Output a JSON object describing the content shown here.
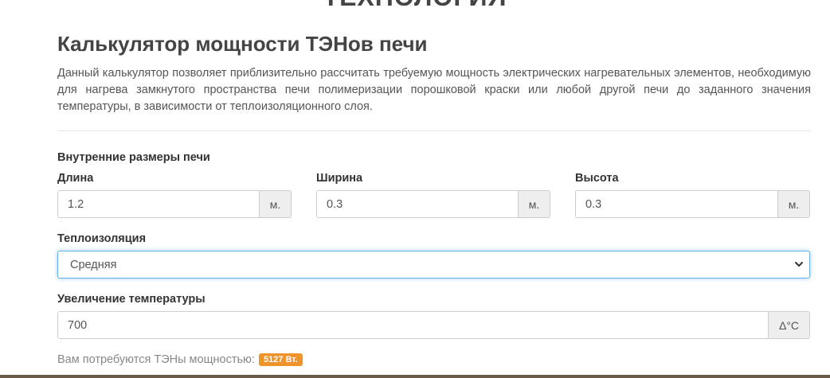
{
  "header": {
    "cut_heading": "ТЕХНОЛОГИЯ"
  },
  "calculator": {
    "title": "Калькулятор мощности ТЭНов печи",
    "description": "Данный калькулятор позволяет приблизительно рассчитать требуемую мощность электрических нагревательных элементов, необходимую для  нагрева замкнутого пространства печи полимеризации порошковой краски или любой другой печи до заданного значения температуры, в зависимости от теплоизоляционного слоя.",
    "dimensions_label": "Внутренние размеры печи",
    "length": {
      "label": "Длина",
      "value": "1.2",
      "unit": "м."
    },
    "width": {
      "label": "Ширина",
      "value": "0.3",
      "unit": "м."
    },
    "height": {
      "label": "Высота",
      "value": "0.3",
      "unit": "м."
    },
    "insulation": {
      "label": "Теплоизоляция",
      "selected": "Средняя"
    },
    "temperature": {
      "label": "Увеличение температуры",
      "value": "700",
      "unit": "Δ°С"
    },
    "result": {
      "text": "Вам потребуются ТЭНы мощностью:",
      "badge": "5127 Вт."
    }
  },
  "colors": {
    "badge": "#f0932b",
    "focus": "#66afe9",
    "bottom_bar": "#6b5a48"
  }
}
